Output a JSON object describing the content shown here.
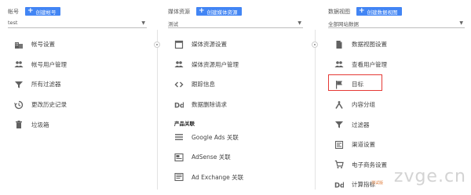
{
  "columns": {
    "account": {
      "label": "帐号",
      "create_label": "创建帐号",
      "selector_value": "test",
      "items": [
        "帐号设置",
        "帐号用户管理",
        "所有过滤器",
        "更改历史记录",
        "垃圾箱"
      ]
    },
    "property": {
      "label": "媒体资源",
      "create_label": "创建媒体资源",
      "selector_value": "测试",
      "items": [
        "媒体资源设置",
        "媒体资源用户管理",
        "跟踪信息",
        "数据删除请求"
      ],
      "section_title": "产品关联",
      "product_links": [
        "Google Ads 关联",
        "AdSense 关联",
        "Ad Exchange 关联"
      ]
    },
    "view": {
      "label": "数据视图",
      "create_label": "创建数据视图",
      "selector_value": "全部网站数据",
      "items": [
        "数据视图设置",
        "查看用户管理",
        "目标",
        "内容分组",
        "过滤器",
        "渠道设置",
        "电子商务设置",
        "计算指标"
      ],
      "calc_badge": "测试版"
    }
  },
  "watermark": "zvge.cn",
  "highlight_color": "#e53935",
  "accent_color": "#4285f4"
}
